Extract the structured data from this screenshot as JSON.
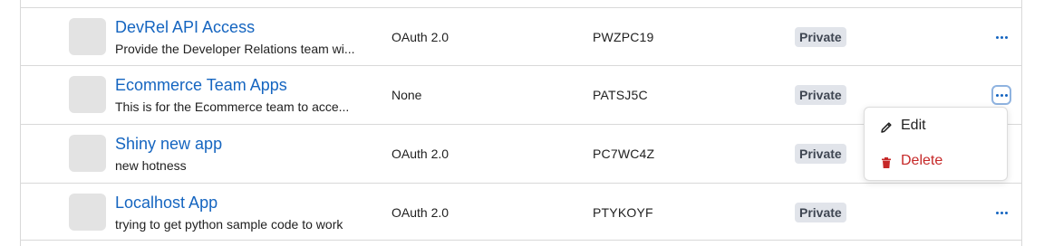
{
  "rows": [
    {
      "name": "DevRel API Access",
      "description": "Provide the Developer Relations team wi...",
      "auth": "OAuth 2.0",
      "code": "PWZPC19",
      "visibility": "Private"
    },
    {
      "name": "Ecommerce Team Apps",
      "description": "This is for the Ecommerce team to acce...",
      "auth": "None",
      "code": "PATSJ5C",
      "visibility": "Private"
    },
    {
      "name": "Shiny new app",
      "description": "new hotness",
      "auth": "OAuth 2.0",
      "code": "PC7WC4Z",
      "visibility": "Private"
    },
    {
      "name": "Localhost App",
      "description": "trying to get python sample code to work",
      "auth": "OAuth 2.0",
      "code": "PTYKOYF",
      "visibility": "Private"
    }
  ],
  "menu": {
    "edit_label": "Edit",
    "delete_label": "Delete",
    "edit_icon": "pencil-icon",
    "delete_icon": "trash-icon"
  },
  "colors": {
    "link": "#1565c0",
    "delete": "#c62828",
    "badge_bg": "#e1e4ea"
  }
}
